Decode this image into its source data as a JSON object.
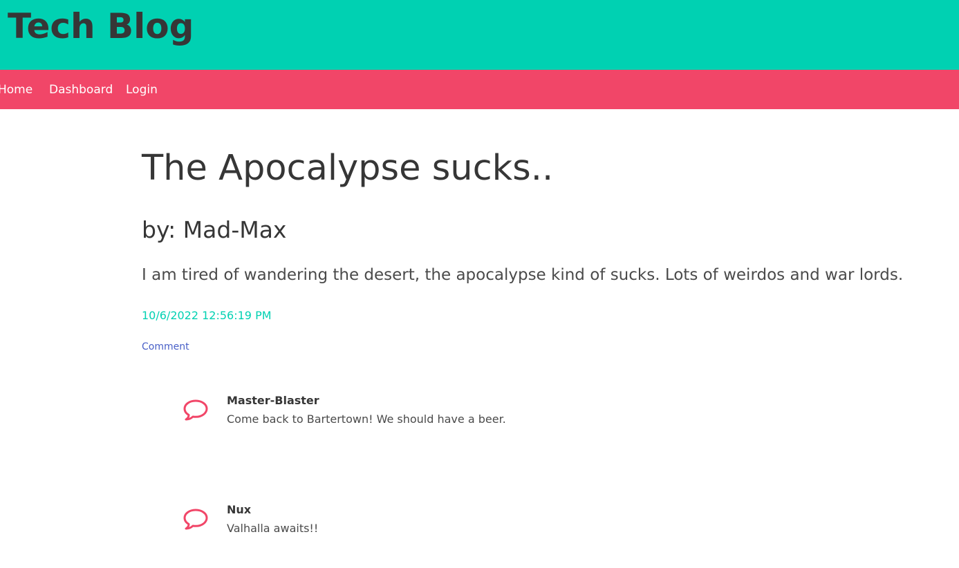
{
  "header": {
    "site_title": "Tech Blog",
    "background_color": "#00d1b2"
  },
  "nav": {
    "background_color": "#f14668",
    "items": [
      {
        "label": "Home"
      },
      {
        "label": "Dashboard"
      },
      {
        "label": "Login"
      }
    ]
  },
  "post": {
    "title": "The Apocalypse sucks..",
    "author": "by: Mad-Max",
    "body": "I am tired of wandering the desert, the apocalypse kind of sucks. Lots of weirdos and war lords.",
    "date": "10/6/2022 12:56:19 PM",
    "comment_link_label": "Comment"
  },
  "comments": [
    {
      "user": "Master-Blaster",
      "text": "Come back to Bartertown! We should have a beer.",
      "icon": "speech-bubble-icon"
    },
    {
      "user": "Nux",
      "text": "Valhalla awaits!!",
      "icon": "speech-bubble-icon"
    }
  ],
  "colors": {
    "accent_teal": "#00d1b2",
    "accent_pink": "#f14668",
    "link_blue": "#485fc7",
    "text_dark": "#363636"
  }
}
